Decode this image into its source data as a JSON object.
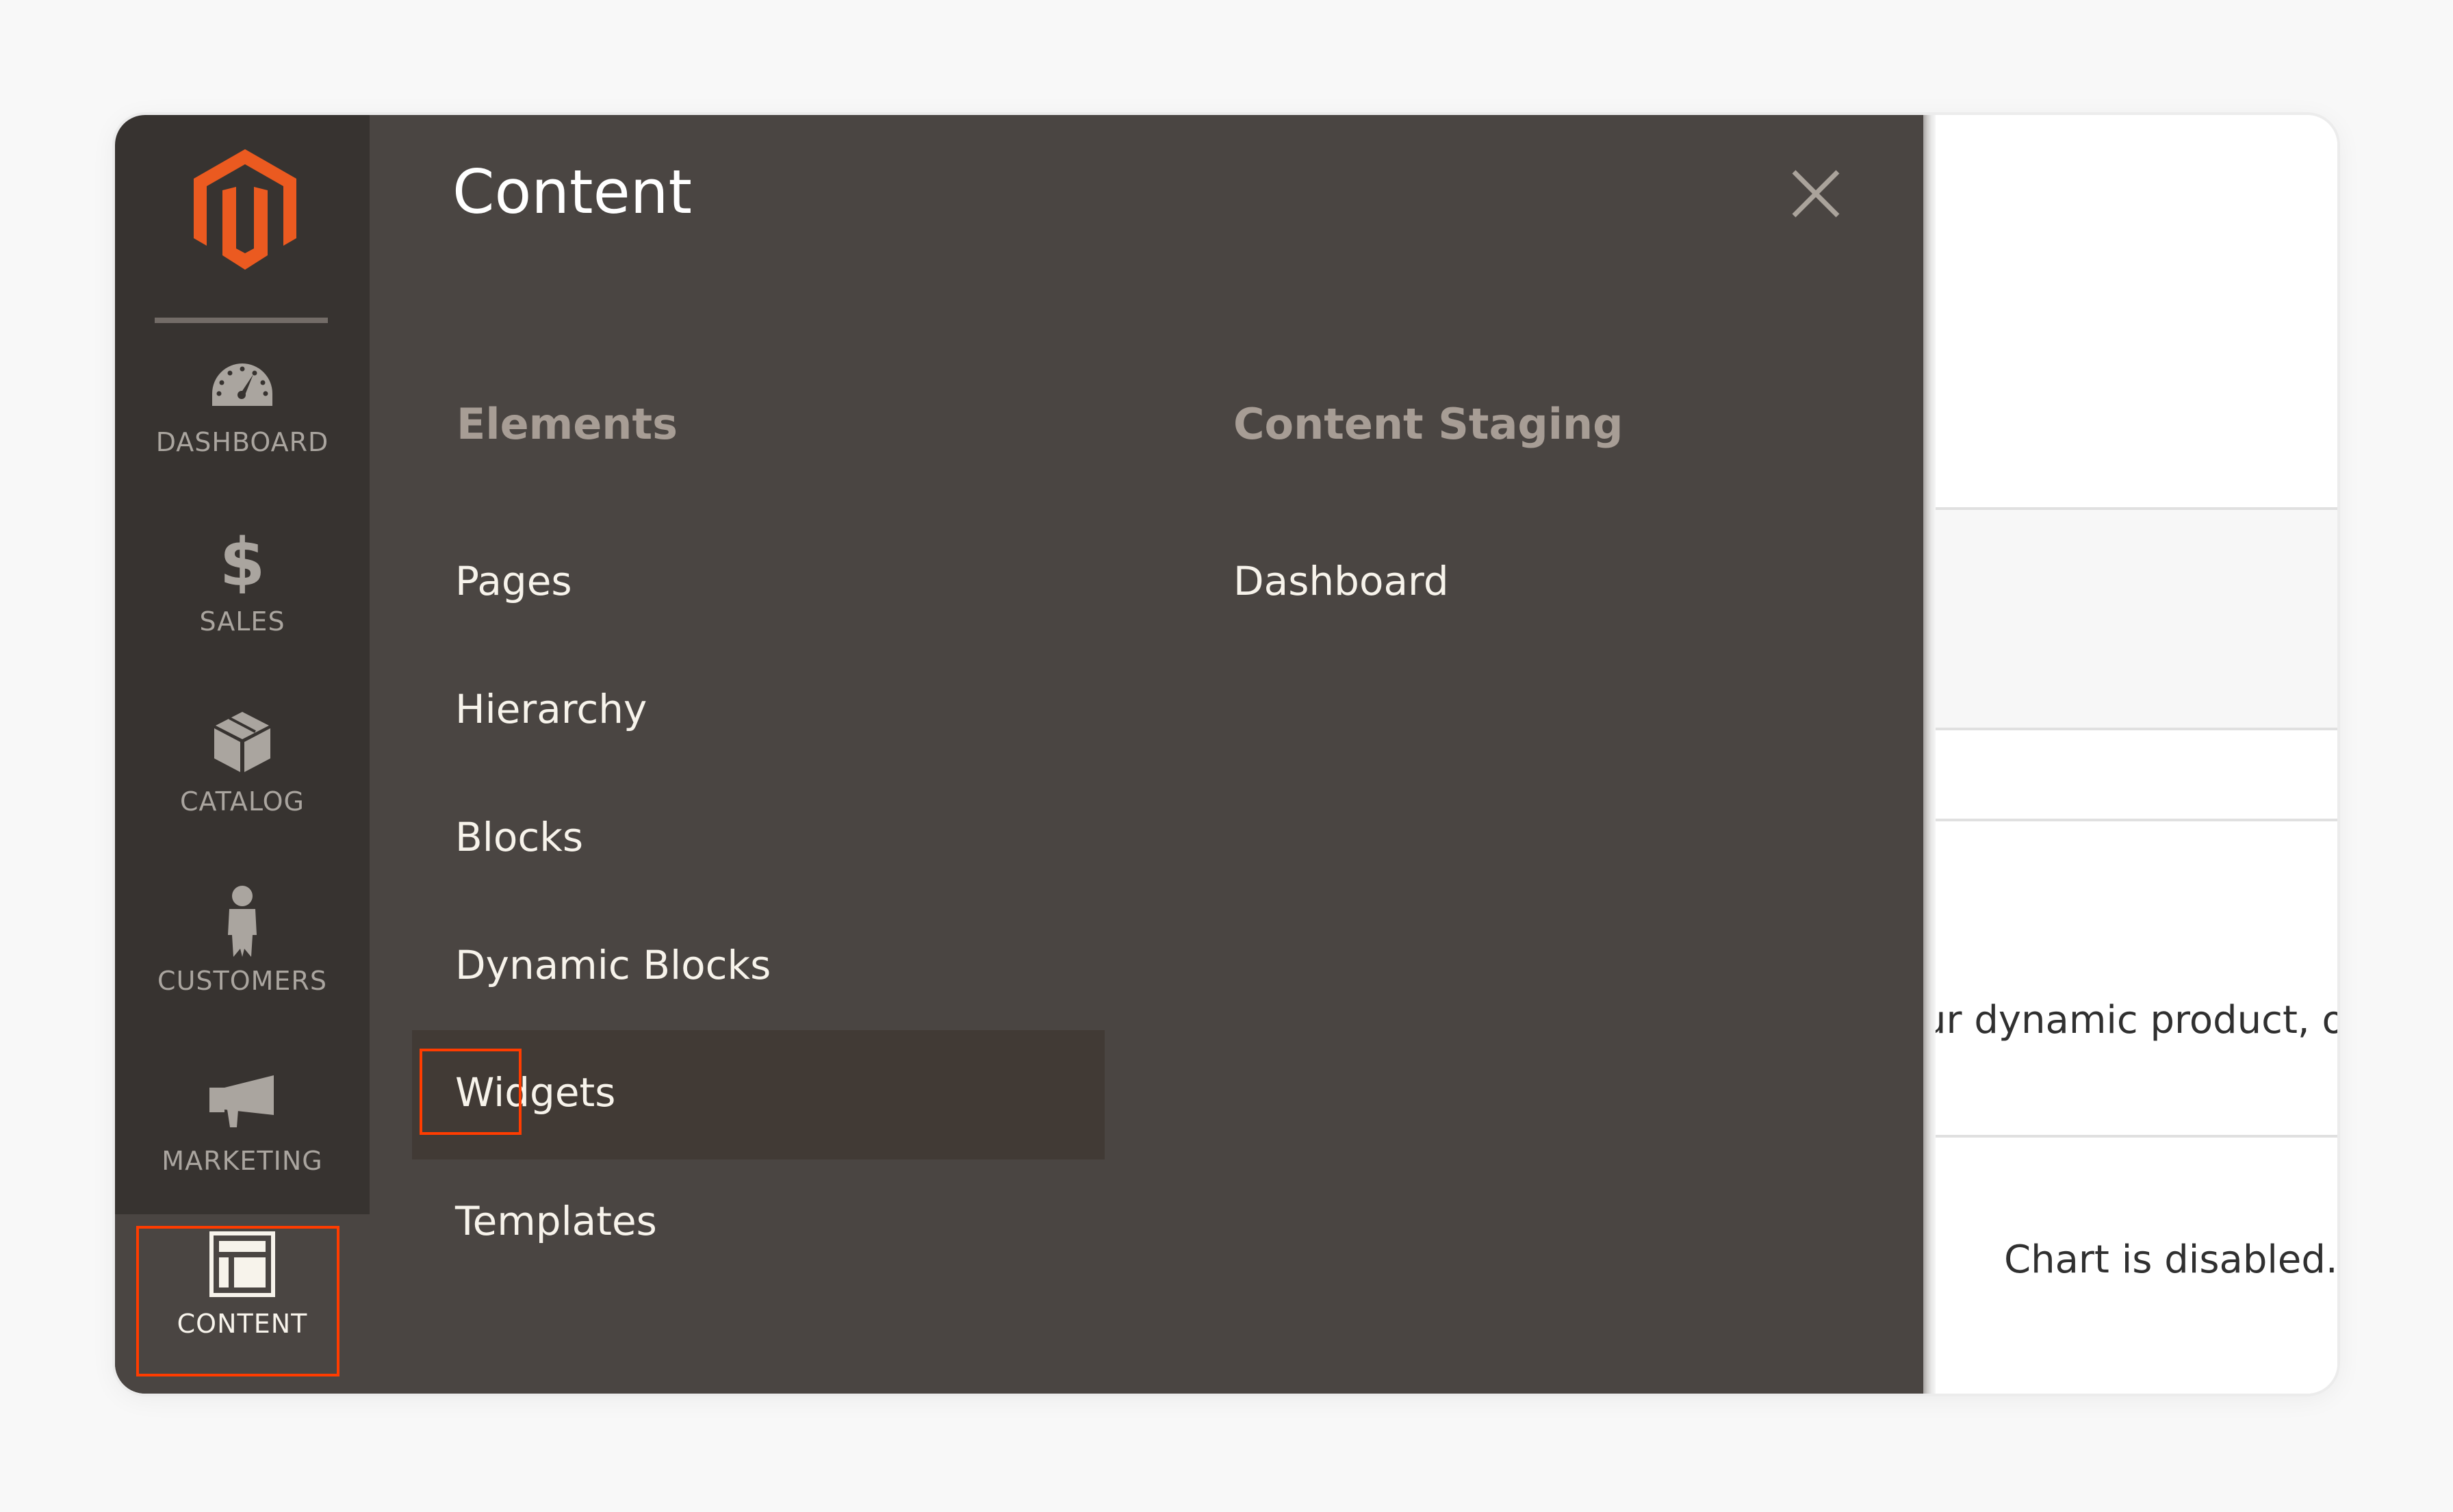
{
  "app": {
    "brand": "Magento",
    "brand_color": "#eb5202",
    "highlight_color": "#ff3c00"
  },
  "sidebar": {
    "items": [
      {
        "label": "DASHBOARD",
        "icon": "dashboard-gauge-icon",
        "active": false
      },
      {
        "label": "SALES",
        "icon": "dollar-icon",
        "active": false
      },
      {
        "label": "CATALOG",
        "icon": "box-icon",
        "active": false
      },
      {
        "label": "CUSTOMERS",
        "icon": "person-icon",
        "active": false
      },
      {
        "label": "MARKETING",
        "icon": "megaphone-icon",
        "active": false
      },
      {
        "label": "CONTENT",
        "icon": "layout-icon",
        "active": true
      }
    ]
  },
  "panel": {
    "title": "Content",
    "close_icon": "close-icon",
    "columns": [
      {
        "header": "Elements",
        "items": [
          {
            "label": "Pages",
            "hover": false
          },
          {
            "label": "Hierarchy",
            "hover": false
          },
          {
            "label": "Blocks",
            "hover": false
          },
          {
            "label": "Dynamic Blocks",
            "hover": false
          },
          {
            "label": "Widgets",
            "hover": true
          },
          {
            "label": "Templates",
            "hover": false
          }
        ]
      },
      {
        "header": "Content Staging",
        "items": [
          {
            "label": "Dashboard",
            "hover": false
          }
        ]
      }
    ]
  },
  "background_page": {
    "partial_text": "ur dynamic product, or",
    "chart_status": "Chart is disabled."
  }
}
